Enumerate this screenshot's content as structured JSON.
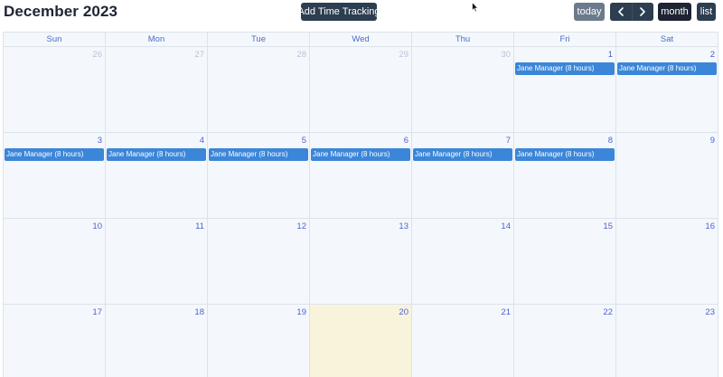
{
  "toolbar": {
    "title": "December 2023",
    "add_label": "Add Time Tracking",
    "today_label": "today",
    "month_label": "month",
    "list_label": "list"
  },
  "weekdays": [
    "Sun",
    "Mon",
    "Tue",
    "Wed",
    "Thu",
    "Fri",
    "Sat"
  ],
  "weeks": [
    [
      {
        "day": "26",
        "other": true
      },
      {
        "day": "27",
        "other": true
      },
      {
        "day": "28",
        "other": true
      },
      {
        "day": "29",
        "other": true
      },
      {
        "day": "30",
        "other": true
      },
      {
        "day": "1",
        "event": "Jane Manager (8 hours)"
      },
      {
        "day": "2",
        "event": "Jane Manager (8 hours)"
      }
    ],
    [
      {
        "day": "3",
        "event": "Jane Manager (8 hours)"
      },
      {
        "day": "4",
        "event": "Jane Manager (8 hours)"
      },
      {
        "day": "5",
        "event": "Jane Manager (8 hours)"
      },
      {
        "day": "6",
        "event": "Jane Manager (8 hours)"
      },
      {
        "day": "7",
        "event": "Jane Manager (8 hours)"
      },
      {
        "day": "8",
        "event": "Jane Manager (8 hours)"
      },
      {
        "day": "9"
      }
    ],
    [
      {
        "day": "10"
      },
      {
        "day": "11"
      },
      {
        "day": "12"
      },
      {
        "day": "13"
      },
      {
        "day": "14"
      },
      {
        "day": "15"
      },
      {
        "day": "16"
      }
    ],
    [
      {
        "day": "17"
      },
      {
        "day": "18"
      },
      {
        "day": "19"
      },
      {
        "day": "20",
        "today": true
      },
      {
        "day": "21"
      },
      {
        "day": "22"
      },
      {
        "day": "23"
      }
    ]
  ],
  "colors": {
    "event": "#3b86d8",
    "today_bg": "#f8f4dc",
    "day_number": "#4f5fd0",
    "weekday": "#4a6cc9",
    "button_dark": "#2c3e50"
  },
  "icons": {
    "prev": "chevron-left-icon",
    "next": "chevron-right-icon",
    "cursor": "mouse-pointer-icon"
  }
}
